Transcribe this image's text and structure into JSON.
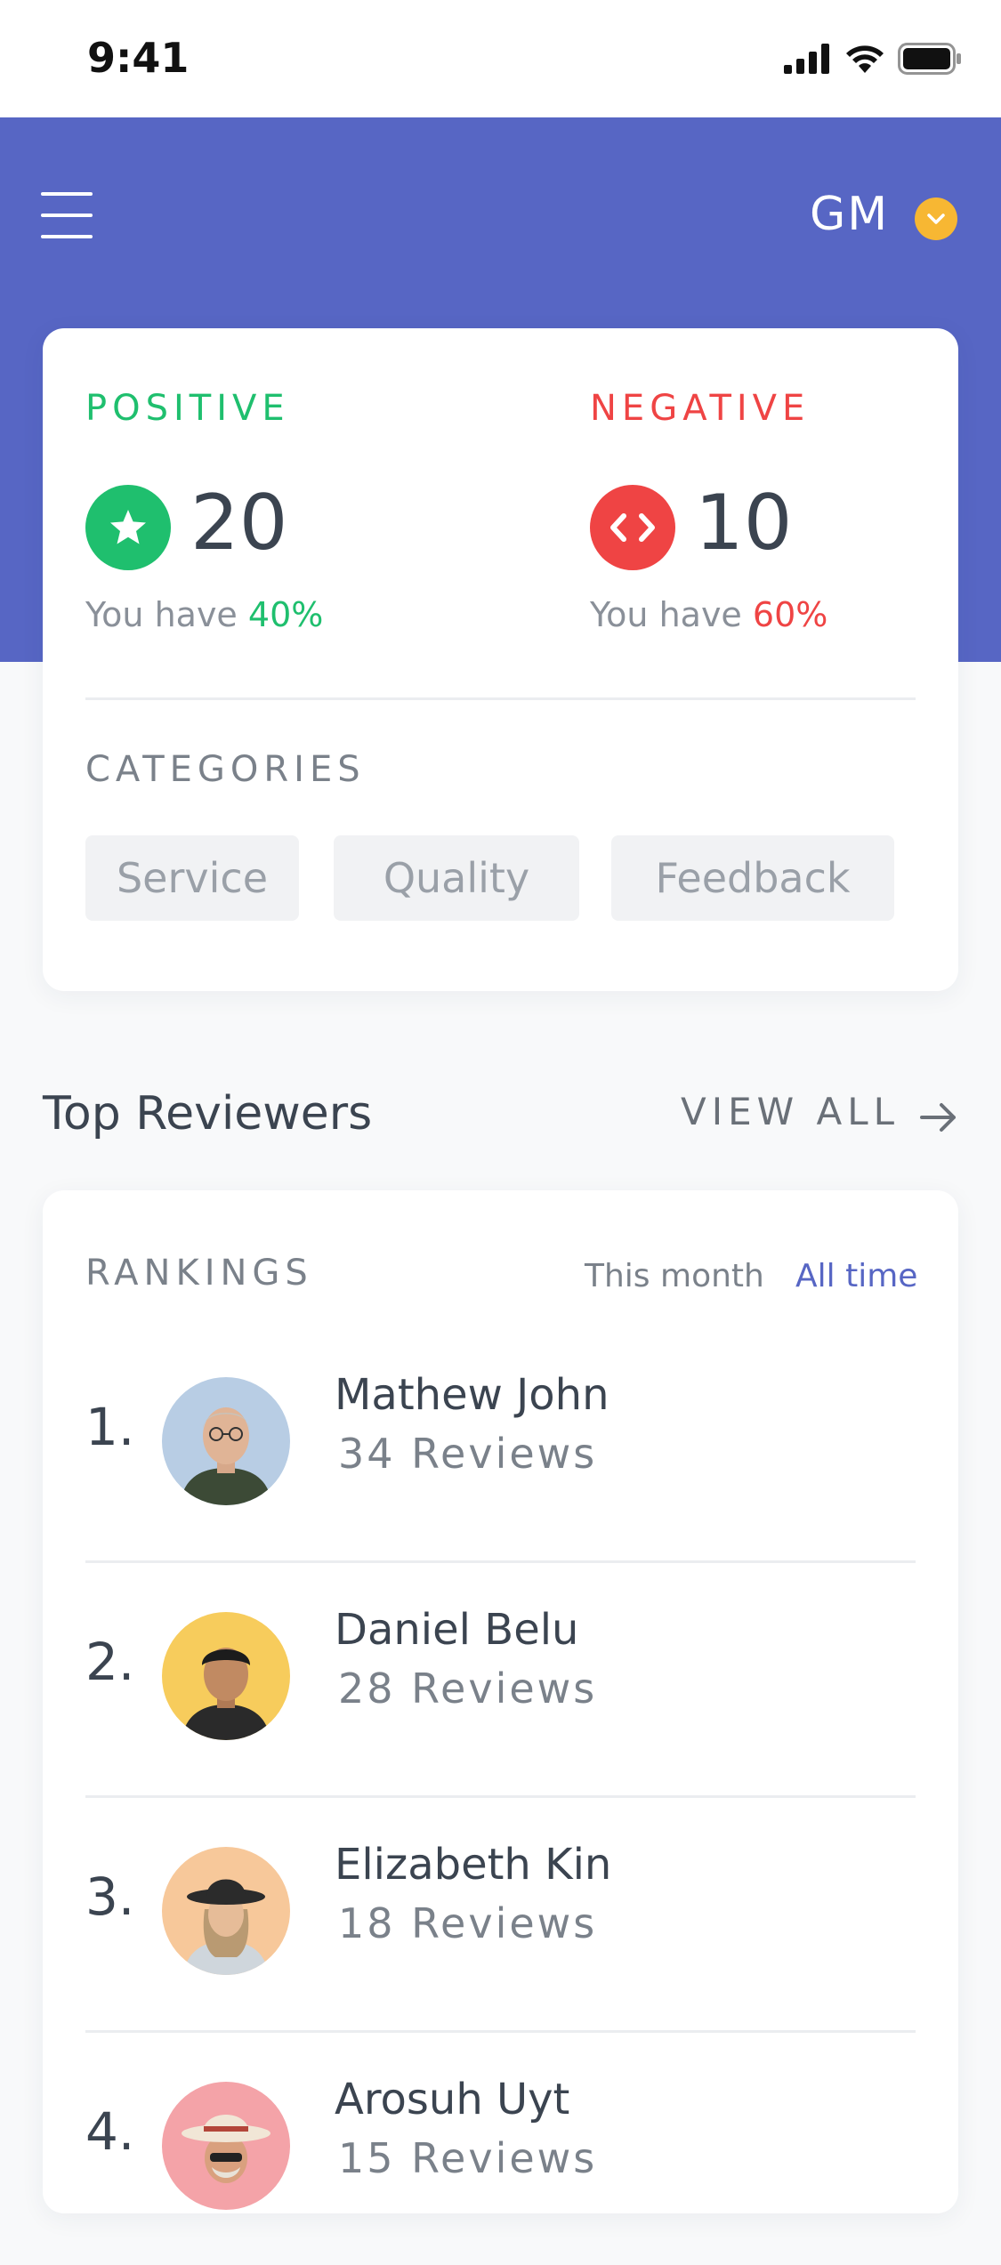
{
  "status_bar": {
    "time": "9:41"
  },
  "header": {
    "user_initials": "GM"
  },
  "stats": {
    "positive": {
      "label": "POSITIVE",
      "value": "20",
      "note_prefix": "You have ",
      "note_value": "40%",
      "color": "#1fbf6e"
    },
    "negative": {
      "label": "NEGATIVE",
      "value": "10",
      "note_prefix": "You have ",
      "note_value": "60%",
      "color": "#ef4444"
    },
    "categories_label": "CATEGORIES",
    "categories": [
      "Service",
      "Quality",
      "Feedback"
    ]
  },
  "reviewers": {
    "title": "Top Reviewers",
    "view_all": "VIEW ALL",
    "rankings_label": "RANKINGS",
    "filters": [
      "This month",
      "All time"
    ],
    "active_filter": "All time",
    "accent": "#5766c4",
    "list": [
      {
        "rank": "1.",
        "name": "Mathew John",
        "reviews": "34 Reviews"
      },
      {
        "rank": "2.",
        "name": "Daniel Belu",
        "reviews": "28 Reviews"
      },
      {
        "rank": "3.",
        "name": "Elizabeth Kin",
        "reviews": "18 Reviews"
      },
      {
        "rank": "4.",
        "name": "Arosuh Uyt",
        "reviews": "15 Reviews"
      }
    ]
  },
  "icons": [
    "signal-icon",
    "wifi-icon",
    "battery-icon",
    "menu-icon",
    "chevron-down-icon",
    "star-icon",
    "code-icon",
    "arrow-right-icon"
  ]
}
